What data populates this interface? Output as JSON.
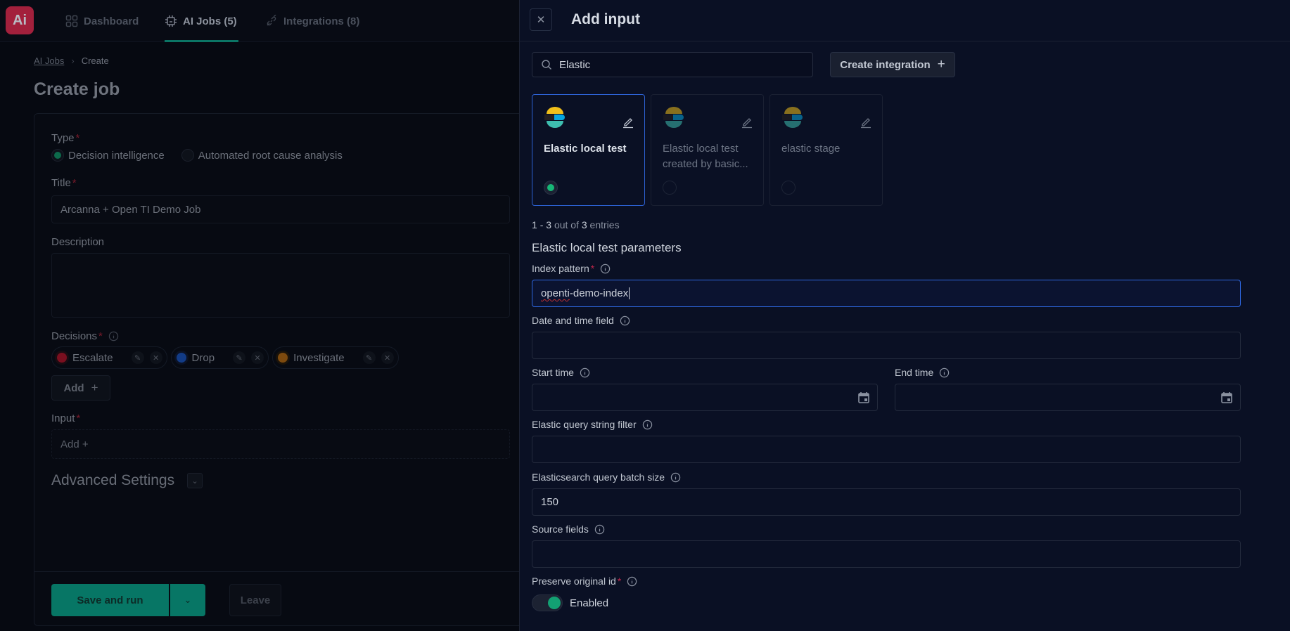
{
  "app": {
    "logo_text": "Ai",
    "nav": [
      {
        "label": "Dashboard",
        "icon": "dashboard-grid-icon",
        "active": false
      },
      {
        "label": "AI Jobs (5)",
        "icon": "chip-icon",
        "active": true
      },
      {
        "label": "Integrations (8)",
        "icon": "plug-icon",
        "active": false
      }
    ]
  },
  "page": {
    "breadcrumb": {
      "parent": "AI Jobs",
      "current": "Create"
    },
    "title": "Create job",
    "form": {
      "type_label": "Type",
      "type_options": [
        {
          "label": "Decision intelligence",
          "selected": true
        },
        {
          "label": "Automated root cause analysis",
          "selected": false
        }
      ],
      "title_label": "Title",
      "title_value": "Arcanna + Open TI Demo Job",
      "description_label": "Description",
      "description_value": "",
      "decisions_label": "Decisions",
      "decisions": [
        {
          "label": "Escalate",
          "color": "#8a1022"
        },
        {
          "label": "Drop",
          "color": "#123d8c"
        },
        {
          "label": "Investigate",
          "color": "#8a520f"
        }
      ],
      "add_label": "Add",
      "input_label": "Input",
      "input_add_label": "Add +",
      "advanced_label": "Advanced Settings"
    },
    "footer": {
      "save_label": "Save and run",
      "leave_label": "Leave"
    }
  },
  "drawer": {
    "title": "Add input",
    "search": {
      "value": "Elastic",
      "placeholder": "Search"
    },
    "create_label": "Create integration",
    "integrations": [
      {
        "name": "Elastic local test",
        "selected": true
      },
      {
        "name": "Elastic local test created by basic...",
        "selected": false
      },
      {
        "name": "elastic stage",
        "selected": false
      }
    ],
    "entries": {
      "from": "1",
      "to": "3",
      "middle": "out of",
      "total": "3",
      "suffix": "entries"
    },
    "params_title": "Elastic local test parameters",
    "fields": {
      "index_pattern": {
        "label": "Index pattern",
        "value_misspelled": "openti",
        "value_rest": "-demo-index",
        "required": true
      },
      "date_time_field": {
        "label": "Date and time field",
        "value": ""
      },
      "start_time": {
        "label": "Start time",
        "value": ""
      },
      "end_time": {
        "label": "End time",
        "value": ""
      },
      "query_filter": {
        "label": "Elastic query string filter",
        "value": ""
      },
      "batch_size": {
        "label": "Elasticsearch query batch size",
        "value": "150"
      },
      "source_fields": {
        "label": "Source fields",
        "value": ""
      },
      "preserve_id": {
        "label": "Preserve original id",
        "required": true,
        "toggle_label": "Enabled",
        "enabled": true
      }
    }
  },
  "colors": {
    "accent_green": "#077665",
    "focus_blue": "#2e67df",
    "logo_red": "#a3203c",
    "required_star": "#c0264a"
  }
}
